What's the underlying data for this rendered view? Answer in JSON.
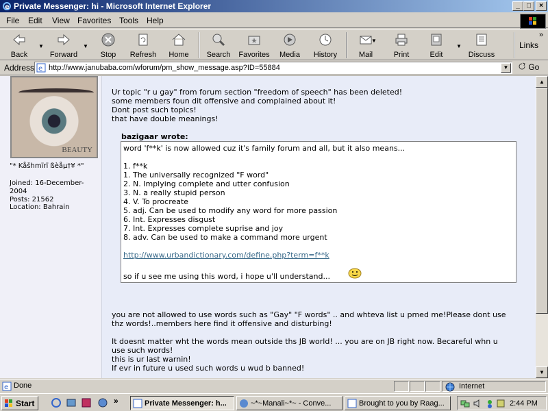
{
  "window": {
    "title": "Private Messenger: hi - Microsoft Internet Explorer",
    "controls": [
      "_",
      "□",
      "×"
    ]
  },
  "menubar": [
    "File",
    "Edit",
    "View",
    "Favorites",
    "Tools",
    "Help"
  ],
  "toolbar": {
    "back": "Back",
    "forward": "Forward",
    "stop": "Stop",
    "refresh": "Refresh",
    "home": "Home",
    "search": "Search",
    "favorites": "Favorites",
    "media": "Media",
    "history": "History",
    "mail": "Mail",
    "print": "Print",
    "edit": "Edit",
    "discuss": "Discuss",
    "links": "Links"
  },
  "address": {
    "label": "Address",
    "url": "http://www.janubaba.com/wforum/pm_show_message.asp?ID=55884",
    "go": "Go"
  },
  "sidebar": {
    "avatar_caption": "BEAUTY",
    "username": "\"* Kåšhmïrï ßèåµ†¥ *\"",
    "joined_line1": "Joined: 16-December-",
    "joined_line2": "2004",
    "posts": "Posts: 21562",
    "location": "Location: Bahrain"
  },
  "message": {
    "intro": [
      "Ur topic \"r u gay\" from forum section \"freedom of speech\" has been deleted!",
      "some members foun dit offensive and complained about it!",
      "Dont post such topics!",
      "that have double meanings!"
    ],
    "quote_author": "bazigaar wrote:",
    "quote_first": "word 'f**k' is now allowed cuz it's family forum and all, but it also means...",
    "quote_list": [
      "1. f**k",
      "1. The universally recognized \"F word\"",
      "2. N. Implying complete and utter confusion",
      "3. N. a really stupid person",
      "4. V. To procreate",
      "5. adj. Can be used to modify any word for more passion",
      "6. Int. Expresses disgust",
      "7. Int. Expresses complete suprise and joy",
      "8. adv. Can be used to make a command more urgent"
    ],
    "quote_link": "http://www.urbandictionary.com/define.php?term=f**k",
    "quote_last": "so if u see me using this word, i hope u'll understand...",
    "body": [
      "you are not allowed to use words such as \"Gay\" \"F words\" .. and whteva list u pmed me!Please dont use",
      "thz words!..members here find it offensive and disturbing!",
      "It doesnt matter wht the words mean outside ths JB world! ... you are on JB right now. Becareful whn u",
      "use such words!",
      "this is ur last warnin!",
      "If evr in future u used such words u wud b banned!"
    ]
  },
  "status": {
    "text": "Done",
    "zone": "Internet"
  },
  "taskbar": {
    "start": "Start",
    "tasks": [
      "Private Messenger: h...",
      "~*~Manali~*~ - Conve...",
      "Brought to you by Raag..."
    ],
    "clock": "2:44 PM",
    "overflow": "»"
  }
}
